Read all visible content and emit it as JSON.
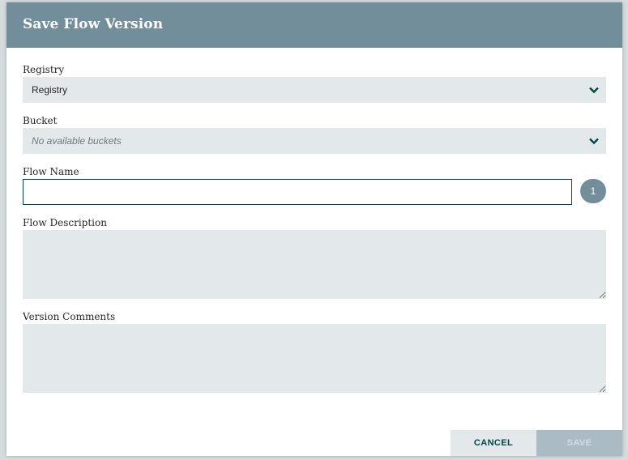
{
  "dialog": {
    "title": "Save Flow Version"
  },
  "registry": {
    "label": "Registry",
    "selected": "Registry",
    "icon": "chevron-down-icon"
  },
  "bucket": {
    "label": "Bucket",
    "selected": "No available buckets",
    "icon": "chevron-down-icon"
  },
  "flow_name": {
    "label": "Flow Name",
    "value": "",
    "badge": "1"
  },
  "flow_description": {
    "label": "Flow Description",
    "value": ""
  },
  "version_comments": {
    "label": "Version Comments",
    "value": ""
  },
  "buttons": {
    "cancel_label": "CANCEL",
    "save_label": "SAVE"
  },
  "colors": {
    "header": "#728e9b",
    "accent": "#004849",
    "field_bg": "#e3e8eb",
    "save_disabled_bg": "#aabbc3"
  }
}
